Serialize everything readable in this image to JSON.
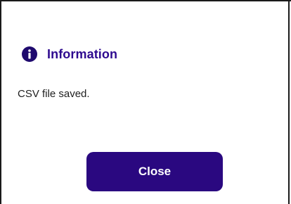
{
  "dialog": {
    "title": "Information",
    "message": "CSV file saved.",
    "close_label": "Close",
    "icon": "info-icon"
  },
  "colors": {
    "accent": "#2e0a8f",
    "button_bg": "#2a0880",
    "icon_bg": "#1f0a6e",
    "text": "#202020"
  }
}
